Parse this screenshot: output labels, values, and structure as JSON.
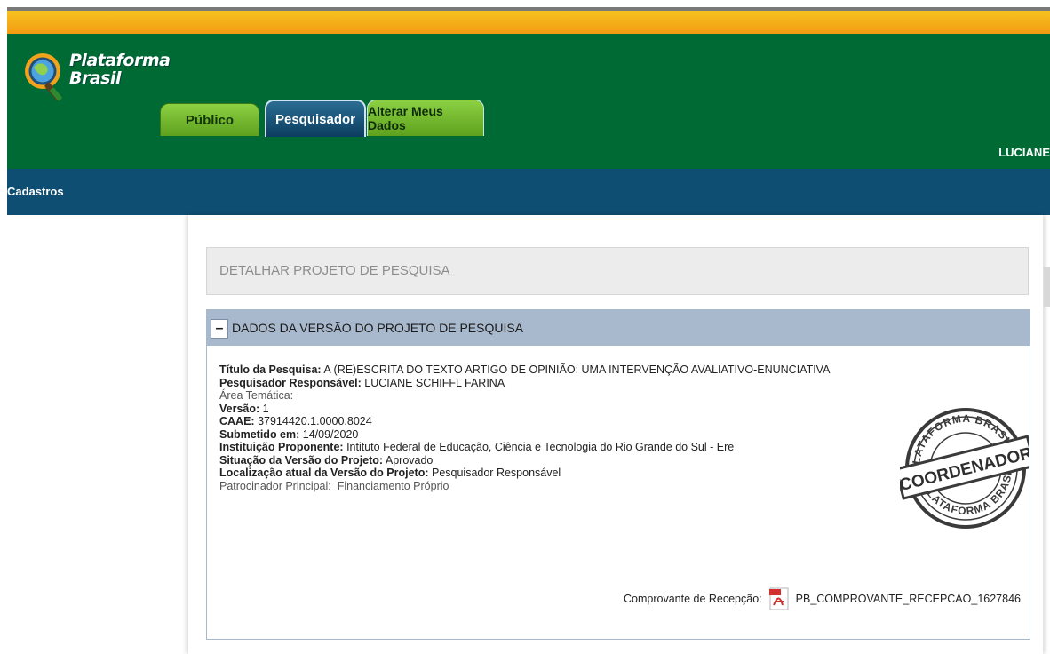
{
  "header": {
    "logo_line1": "Plataforma",
    "logo_line2": "Brasil",
    "tabs": [
      {
        "label": "Público"
      },
      {
        "label": "Pesquisador"
      },
      {
        "label": "Alterar Meus Dados"
      }
    ],
    "user": "LUCIANE"
  },
  "nav": {
    "menu": "Cadastros"
  },
  "page": {
    "title": "DETALHAR PROJETO DE PESQUISA",
    "section_title": "DADOS DA VERSÃO DO PROJETO DE PESQUISA",
    "collapse_symbol": "–"
  },
  "details": {
    "titulo": {
      "label": "Título da Pesquisa:",
      "value": "A (RE)ESCRITA DO TEXTO ARTIGO DE OPINIÃO: UMA INTERVENÇÃO AVALIATIVO-ENUNCIATIVA"
    },
    "pesquisador": {
      "label": "Pesquisador Responsável:",
      "value": "LUCIANE SCHIFFL FARINA"
    },
    "area": {
      "label": "Área Temática:",
      "value": ""
    },
    "versao": {
      "label": "Versão:",
      "value": "1"
    },
    "caae": {
      "label": "CAAE:",
      "value": "37914420.1.0000.8024"
    },
    "submetido": {
      "label": "Submetido em:",
      "value": "14/09/2020"
    },
    "instituicao": {
      "label": "Instituição Proponente:",
      "value": "Intituto Federal de Educação, Ciência e Tecnologia do Rio Grande do Sul - Ere"
    },
    "situacao": {
      "label": "Situação da Versão do Projeto:",
      "value": "Aprovado"
    },
    "localizacao": {
      "label": "Localização atual da Versão do Projeto:",
      "value": "Pesquisador Responsável"
    },
    "patrocinador": {
      "label": "Patrocinador Principal:",
      "value": "Financiamento Próprio"
    }
  },
  "stamp": {
    "top_text": "PLATAFORMA BRASIL",
    "center_text": "COORDENADOR",
    "bottom_text": "PLATAFORMA BRASIL"
  },
  "receipt": {
    "label": "Comprovante de Recepção:",
    "file": "PB_COMPROVANTE_RECEPCAO_1627846"
  },
  "colors": {
    "header_green": "#006a35",
    "nav_blue": "#0f4e73",
    "tab_green": "#6fb52a",
    "panel_head": "#a9b9cd"
  }
}
